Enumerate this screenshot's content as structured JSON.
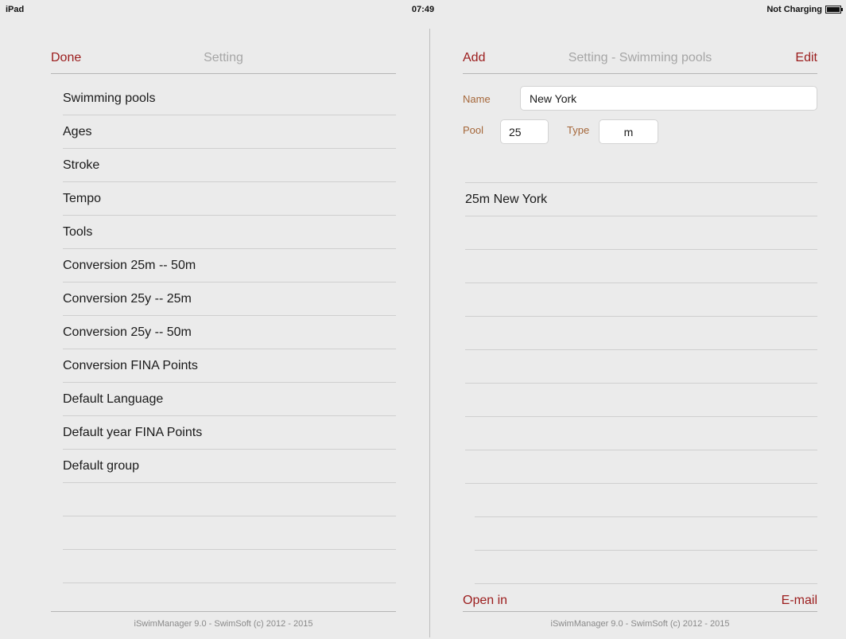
{
  "status_bar": {
    "device": "iPad",
    "time": "07:49",
    "battery_status": "Not Charging",
    "battery_icon": "battery-icon"
  },
  "left_panel": {
    "done_label": "Done",
    "title": "Setting",
    "items": [
      "Swimming pools",
      "Ages",
      "Stroke",
      "Tempo",
      "Tools",
      "Conversion 25m -- 50m",
      "Conversion 25y -- 25m",
      "Conversion 25y -- 50m",
      "Conversion FINA Points",
      "Default Language",
      "Default year FINA Points",
      "Default group"
    ],
    "footer": "iSwimManager 9.0 - SwimSoft (c) 2012 - 2015"
  },
  "right_panel": {
    "add_label": "Add",
    "title": "Setting - Swimming pools",
    "edit_label": "Edit",
    "form": {
      "name_label": "Name",
      "name_value": "New York",
      "pool_label": "Pool",
      "pool_value": "25",
      "type_label": "Type",
      "type_value": "m"
    },
    "pools": [
      "25m New York"
    ],
    "open_in_label": "Open in",
    "email_label": "E-mail",
    "footer": "iSwimManager 9.0 - SwimSoft (c) 2012 - 2015"
  },
  "colors": {
    "accent": "#9b1c1c",
    "label": "#a5673a",
    "title": "#a6a6a6",
    "background": "#ebebeb"
  }
}
